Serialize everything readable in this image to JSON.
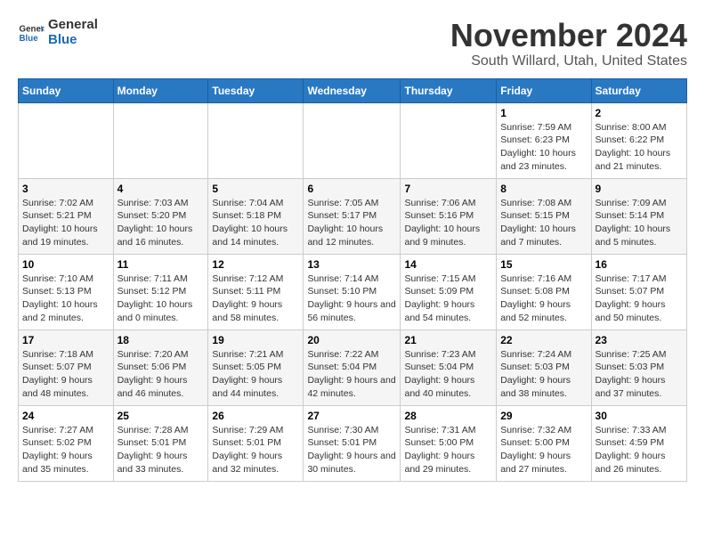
{
  "logo": {
    "line1": "General",
    "line2": "Blue"
  },
  "title": "November 2024",
  "subtitle": "South Willard, Utah, United States",
  "days_header": [
    "Sunday",
    "Monday",
    "Tuesday",
    "Wednesday",
    "Thursday",
    "Friday",
    "Saturday"
  ],
  "weeks": [
    [
      {
        "day": "",
        "info": ""
      },
      {
        "day": "",
        "info": ""
      },
      {
        "day": "",
        "info": ""
      },
      {
        "day": "",
        "info": ""
      },
      {
        "day": "",
        "info": ""
      },
      {
        "day": "1",
        "info": "Sunrise: 7:59 AM\nSunset: 6:23 PM\nDaylight: 10 hours and 23 minutes."
      },
      {
        "day": "2",
        "info": "Sunrise: 8:00 AM\nSunset: 6:22 PM\nDaylight: 10 hours and 21 minutes."
      }
    ],
    [
      {
        "day": "3",
        "info": "Sunrise: 7:02 AM\nSunset: 5:21 PM\nDaylight: 10 hours and 19 minutes."
      },
      {
        "day": "4",
        "info": "Sunrise: 7:03 AM\nSunset: 5:20 PM\nDaylight: 10 hours and 16 minutes."
      },
      {
        "day": "5",
        "info": "Sunrise: 7:04 AM\nSunset: 5:18 PM\nDaylight: 10 hours and 14 minutes."
      },
      {
        "day": "6",
        "info": "Sunrise: 7:05 AM\nSunset: 5:17 PM\nDaylight: 10 hours and 12 minutes."
      },
      {
        "day": "7",
        "info": "Sunrise: 7:06 AM\nSunset: 5:16 PM\nDaylight: 10 hours and 9 minutes."
      },
      {
        "day": "8",
        "info": "Sunrise: 7:08 AM\nSunset: 5:15 PM\nDaylight: 10 hours and 7 minutes."
      },
      {
        "day": "9",
        "info": "Sunrise: 7:09 AM\nSunset: 5:14 PM\nDaylight: 10 hours and 5 minutes."
      }
    ],
    [
      {
        "day": "10",
        "info": "Sunrise: 7:10 AM\nSunset: 5:13 PM\nDaylight: 10 hours and 2 minutes."
      },
      {
        "day": "11",
        "info": "Sunrise: 7:11 AM\nSunset: 5:12 PM\nDaylight: 10 hours and 0 minutes."
      },
      {
        "day": "12",
        "info": "Sunrise: 7:12 AM\nSunset: 5:11 PM\nDaylight: 9 hours and 58 minutes."
      },
      {
        "day": "13",
        "info": "Sunrise: 7:14 AM\nSunset: 5:10 PM\nDaylight: 9 hours and 56 minutes."
      },
      {
        "day": "14",
        "info": "Sunrise: 7:15 AM\nSunset: 5:09 PM\nDaylight: 9 hours and 54 minutes."
      },
      {
        "day": "15",
        "info": "Sunrise: 7:16 AM\nSunset: 5:08 PM\nDaylight: 9 hours and 52 minutes."
      },
      {
        "day": "16",
        "info": "Sunrise: 7:17 AM\nSunset: 5:07 PM\nDaylight: 9 hours and 50 minutes."
      }
    ],
    [
      {
        "day": "17",
        "info": "Sunrise: 7:18 AM\nSunset: 5:07 PM\nDaylight: 9 hours and 48 minutes."
      },
      {
        "day": "18",
        "info": "Sunrise: 7:20 AM\nSunset: 5:06 PM\nDaylight: 9 hours and 46 minutes."
      },
      {
        "day": "19",
        "info": "Sunrise: 7:21 AM\nSunset: 5:05 PM\nDaylight: 9 hours and 44 minutes."
      },
      {
        "day": "20",
        "info": "Sunrise: 7:22 AM\nSunset: 5:04 PM\nDaylight: 9 hours and 42 minutes."
      },
      {
        "day": "21",
        "info": "Sunrise: 7:23 AM\nSunset: 5:04 PM\nDaylight: 9 hours and 40 minutes."
      },
      {
        "day": "22",
        "info": "Sunrise: 7:24 AM\nSunset: 5:03 PM\nDaylight: 9 hours and 38 minutes."
      },
      {
        "day": "23",
        "info": "Sunrise: 7:25 AM\nSunset: 5:03 PM\nDaylight: 9 hours and 37 minutes."
      }
    ],
    [
      {
        "day": "24",
        "info": "Sunrise: 7:27 AM\nSunset: 5:02 PM\nDaylight: 9 hours and 35 minutes."
      },
      {
        "day": "25",
        "info": "Sunrise: 7:28 AM\nSunset: 5:01 PM\nDaylight: 9 hours and 33 minutes."
      },
      {
        "day": "26",
        "info": "Sunrise: 7:29 AM\nSunset: 5:01 PM\nDaylight: 9 hours and 32 minutes."
      },
      {
        "day": "27",
        "info": "Sunrise: 7:30 AM\nSunset: 5:01 PM\nDaylight: 9 hours and 30 minutes."
      },
      {
        "day": "28",
        "info": "Sunrise: 7:31 AM\nSunset: 5:00 PM\nDaylight: 9 hours and 29 minutes."
      },
      {
        "day": "29",
        "info": "Sunrise: 7:32 AM\nSunset: 5:00 PM\nDaylight: 9 hours and 27 minutes."
      },
      {
        "day": "30",
        "info": "Sunrise: 7:33 AM\nSunset: 4:59 PM\nDaylight: 9 hours and 26 minutes."
      }
    ]
  ]
}
